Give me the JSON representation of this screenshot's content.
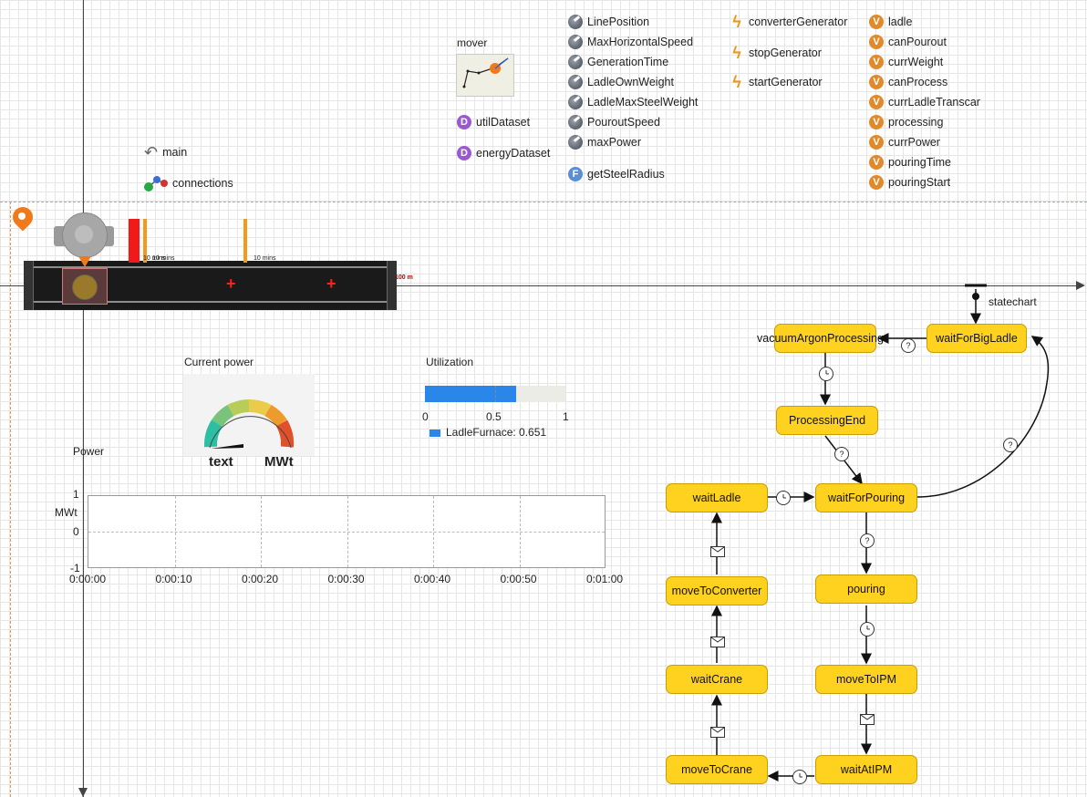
{
  "palette": {
    "parameters": [
      "LinePosition",
      "MaxHorizontalSpeed",
      "GenerationTime",
      "LadleOwnWeight",
      "LadleMaxSteelWeight",
      "PouroutSpeed",
      "maxPower"
    ],
    "function": {
      "icon": "F",
      "label": "getSteelRadius"
    },
    "events": [
      "converterGenerator",
      "stopGenerator",
      "startGenerator"
    ],
    "variables": [
      "ladle",
      "canPourout",
      "currWeight",
      "canProcess",
      "currLadleTranscar",
      "processing",
      "currPower",
      "pouringTime",
      "pouringStart"
    ],
    "datasets": [
      {
        "icon": "D",
        "label": "utilDataset"
      },
      {
        "icon": "D",
        "label": "energyDataset"
      }
    ],
    "mover": {
      "label": "mover"
    },
    "main": {
      "label": "main"
    },
    "connections": {
      "label": "connections"
    },
    "variable_icon": "V"
  },
  "crane": {
    "marker1": "10 mins",
    "marker2": "10 mins",
    "marker3": "10 mins",
    "length_label": "100 m",
    "plus_symbol": "+"
  },
  "gauge": {
    "title": "Current power",
    "value_text": "text",
    "unit": "MWt"
  },
  "utilization": {
    "title": "Utilization",
    "ticks": [
      "0",
      "0.5",
      "1"
    ],
    "legend_label": "LadleFurnace: 0.651",
    "value": 0.651,
    "color": "#2a86e8"
  },
  "power_chart": {
    "title": "Power",
    "ylabel": "MWt",
    "yticks": [
      "1",
      "0",
      "-1"
    ],
    "xticks": [
      "0:00:00",
      "0:00:10",
      "0:00:20",
      "0:00:30",
      "0:00:40",
      "0:00:50",
      "0:01:00"
    ]
  },
  "chart_data": {
    "type": "line",
    "title": "Power",
    "xlabel": "",
    "ylabel": "MWt",
    "x": [
      "0:00:00",
      "0:00:10",
      "0:00:20",
      "0:00:30",
      "0:00:40",
      "0:00:50",
      "0:01:00"
    ],
    "ylim": [
      -1,
      1
    ],
    "series": [],
    "grid": true
  },
  "statechart": {
    "label": "statechart",
    "states": {
      "vacuumArgonProcessing": "vacuumArgonProcessing",
      "waitForBigLadle": "waitForBigLadle",
      "processingEnd": "ProcessingEnd",
      "waitLadle": "waitLadle",
      "waitForPouring": "waitForPouring",
      "moveToConverter": "moveToConverter",
      "pouring": "pouring",
      "waitCrane": "waitCrane",
      "moveToIPM": "moveToIPM",
      "moveToCrane": "moveToCrane",
      "waitAtIPM": "waitAtIPM"
    },
    "trigger_condition": "?",
    "trigger_timeout": "timeout",
    "trigger_message": "message"
  }
}
